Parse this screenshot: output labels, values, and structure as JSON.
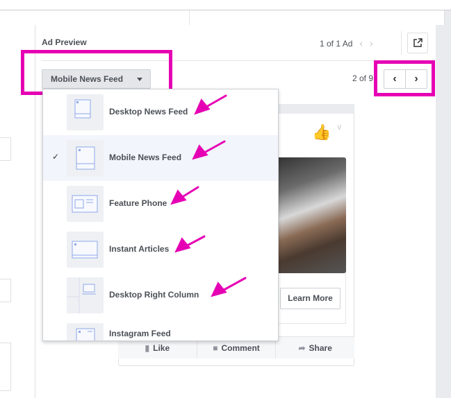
{
  "panel": {
    "title": "Ad Preview",
    "ad_count": "1 of 1 Ad",
    "page_count": "2 of 9"
  },
  "dropdown": {
    "selected": "Mobile News Feed",
    "items": [
      {
        "label": "Desktop News Feed",
        "selected": false
      },
      {
        "label": "Mobile News Feed",
        "selected": true
      },
      {
        "label": "Feature Phone",
        "selected": false
      },
      {
        "label": "Instant Articles",
        "selected": false
      },
      {
        "label": "Desktop Right Column",
        "selected": false
      },
      {
        "label": "Instagram Feed",
        "selected": false
      }
    ]
  },
  "ad": {
    "cta": "Learn More",
    "actions": {
      "like": "Like",
      "comment": "Comment",
      "share": "Share"
    }
  },
  "colors": {
    "highlight": "#e600b4",
    "accent": "#4267b2"
  },
  "icons": {
    "check": "✓",
    "prev": "‹",
    "next": "›"
  }
}
